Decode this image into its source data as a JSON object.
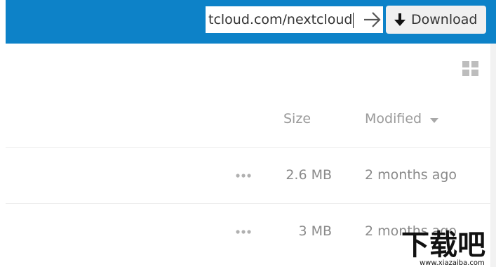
{
  "header": {
    "url_value": "tcloud.com/nextcloud",
    "go_icon": "arrow-right-icon",
    "download_icon": "arrow-down-icon",
    "download_label": "Download",
    "background_color": "#0d82c8"
  },
  "view_toggle": {
    "icon": "grid-view-icon"
  },
  "table": {
    "columns": {
      "size": "Size",
      "modified": "Modified",
      "sort_icon": "caret-down-icon"
    },
    "rows": [
      {
        "more_icon": "more-dots-icon",
        "size": "2.6 MB",
        "modified": "2 months ago"
      },
      {
        "more_icon": "more-dots-icon",
        "size": "3 MB",
        "modified": "2 months ago"
      }
    ]
  },
  "watermark": {
    "text": "下载吧",
    "url": "www.xiazaiba.com"
  }
}
